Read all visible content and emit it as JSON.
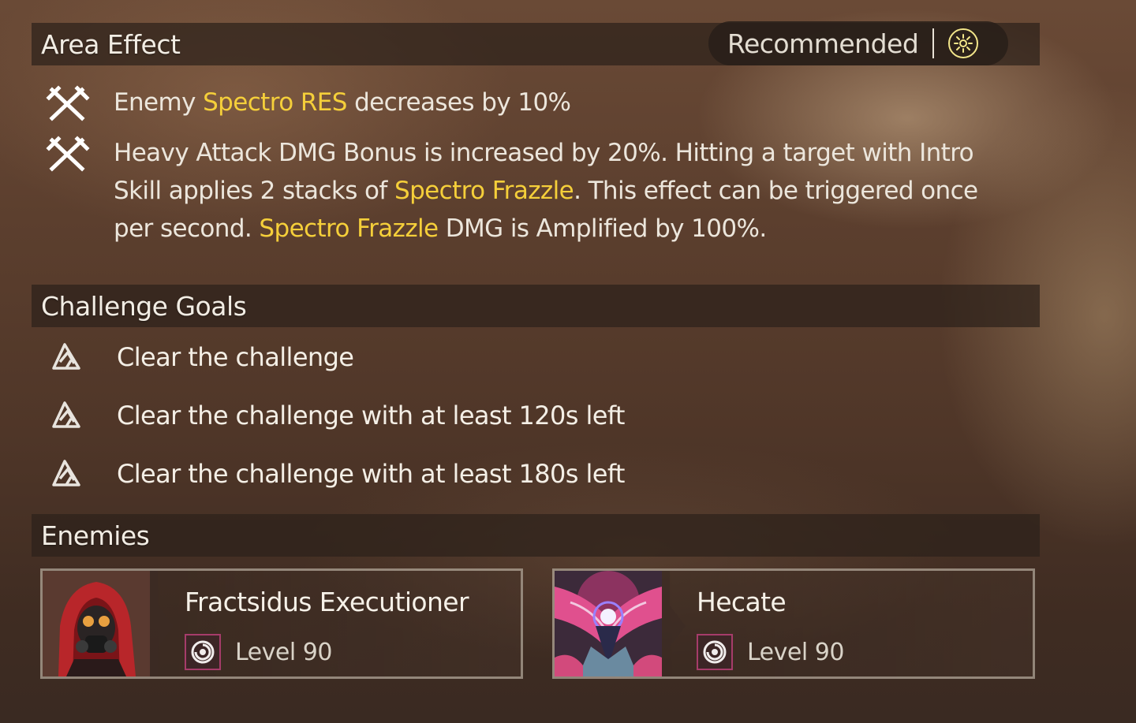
{
  "area_effect": {
    "title": "Area Effect",
    "recommended_label": "Recommended",
    "effects": [
      {
        "icon": "crossed-swords-icon",
        "segments": [
          {
            "text": "Enemy ",
            "highlight": false
          },
          {
            "text": "Spectro RES",
            "highlight": true
          },
          {
            "text": " decreases by 10%",
            "highlight": false
          }
        ]
      },
      {
        "icon": "crossed-swords-icon",
        "segments": [
          {
            "text": "Heavy Attack DMG Bonus is increased by 20%. Hitting a target with Intro Skill applies 2 stacks of ",
            "highlight": false
          },
          {
            "text": "Spectro Frazzle",
            "highlight": true
          },
          {
            "text": ". This effect can be triggered once per second. ",
            "highlight": false
          },
          {
            "text": "Spectro Frazzle",
            "highlight": true
          },
          {
            "text": " DMG is Amplified by 100%.",
            "highlight": false
          }
        ]
      }
    ]
  },
  "challenge_goals": {
    "title": "Challenge Goals",
    "goals": [
      "Clear the challenge",
      "Clear the challenge with at least 120s left",
      "Clear the challenge with at least 180s left"
    ]
  },
  "enemies": {
    "title": "Enemies",
    "list": [
      {
        "name": "Fractsidus Executioner",
        "level": "Level 90",
        "element_icon": "spectro-swirl-icon"
      },
      {
        "name": "Hecate",
        "level": "Level 90",
        "element_icon": "spectro-swirl-icon"
      }
    ]
  },
  "colors": {
    "highlight": "#f5cf3a",
    "spectro_badge": "#f3e68a",
    "element_border": "#a63c6a"
  }
}
